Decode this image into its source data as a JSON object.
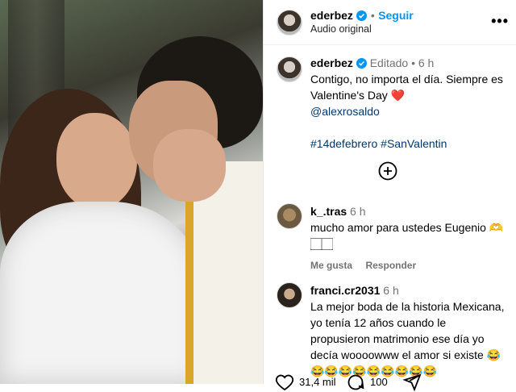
{
  "header": {
    "username": "ederbez",
    "follow_label": "Seguir",
    "audio": "Audio original",
    "more_label": "•••"
  },
  "caption": {
    "username": "ederbez",
    "edited": "Editado",
    "separator": "•",
    "time": "6 h",
    "text": "Contigo, no importa el día. Siempre es Valentine's Day",
    "heart": "❤️",
    "mention": "@alexrosaldo",
    "hashtags": "#14defebrero #SanValentin"
  },
  "comments": [
    {
      "username": "k_.tras",
      "time": "6 h",
      "text_line1": "mucho amor para ustedes Eugenio 🫶",
      "text_line2": "🏻🏻",
      "like_label": "Me gusta",
      "reply_label": "Responder"
    },
    {
      "username": "franci.cr2031",
      "time": "6 h",
      "text": "La mejor boda de la historia Mexicana, yo tenía 12 años cuando le propusieron matrimonio ese día yo decía woooowww el amor si existe 😂",
      "emoji_row": "😂😂😂😂😂😂😂😂😂"
    }
  ],
  "actions": {
    "likes": "31,4 mil",
    "comments": "100"
  },
  "colors": {
    "link": "#00376b",
    "accent": "#0095f6",
    "heart": "#ed4956"
  },
  "icons": [
    "verified-badge-icon",
    "more-options-icon",
    "add-comment-icon",
    "heart-icon",
    "comment-icon",
    "share-icon"
  ]
}
